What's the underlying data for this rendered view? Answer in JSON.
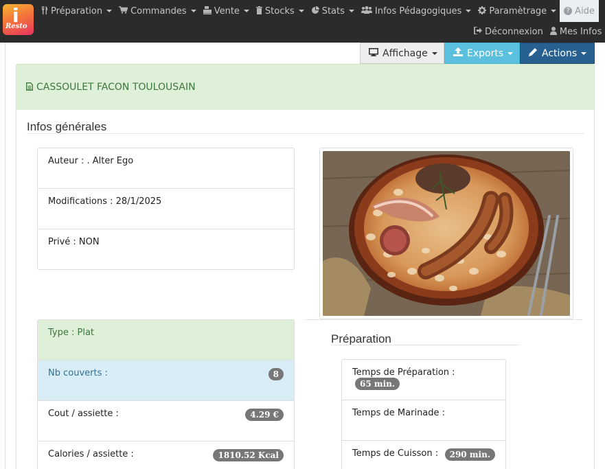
{
  "logo": {
    "letter": "i",
    "text": "Resto"
  },
  "nav": {
    "items": [
      {
        "label": "Préparation",
        "icon": "cutlery-icon"
      },
      {
        "label": "Commandes",
        "icon": "cart-icon"
      },
      {
        "label": "Vente",
        "icon": "register-icon"
      },
      {
        "label": "Stocks",
        "icon": "trash-icon"
      },
      {
        "label": "Stats",
        "icon": "pie-chart-icon"
      },
      {
        "label": "Infos Pédagogiques",
        "icon": "users-icon"
      },
      {
        "label": "Paramètrage",
        "icon": "gear-icon"
      }
    ],
    "help_label": "Aide",
    "logout_label": "Déconnexion",
    "account_label": "Mes Infos"
  },
  "toolbar": {
    "display_label": "Affichage",
    "exports_label": "Exports",
    "actions_label": "Actions"
  },
  "recipe": {
    "title": "CASSOULET FACON TOULOUSAIN"
  },
  "general": {
    "title": "Infos générales",
    "author": "Auteur : . Alter Ego",
    "modified": "Modifications : 28/1/2025",
    "private": "Privé : NON"
  },
  "details": {
    "type": "Type : Plat",
    "covers_label": "Nb couverts :",
    "covers_value": "8",
    "cost_label": "Cout / assiette :",
    "cost_value": "4.29 €",
    "calories_label": "Calories / assiette :",
    "calories_value": "1810.52 Kcal"
  },
  "preparation": {
    "title": "Préparation",
    "prep_label": "Temps de Préparation :",
    "prep_value": "65 min.",
    "marinade_label": "Temps de Marinade :",
    "cook_label": "Temps de Cuisson :",
    "cook_value": "290 min."
  },
  "colors": {
    "navbar": "#2b2b2b",
    "success_bg": "#dff0d8",
    "success_text": "#3c763d",
    "info_bg": "#d9edf7",
    "info_text": "#31708f",
    "btn_info": "#5bc0de",
    "btn_primary": "#286090"
  }
}
